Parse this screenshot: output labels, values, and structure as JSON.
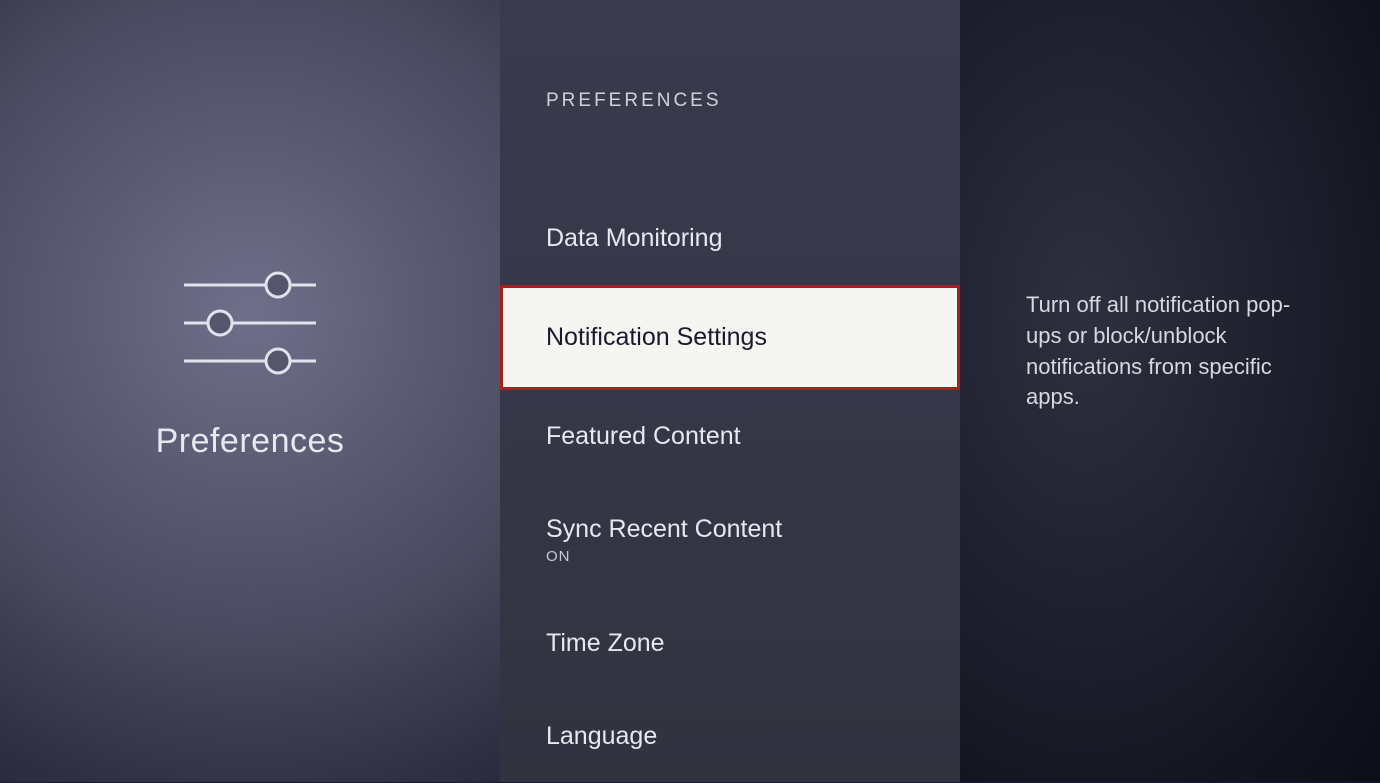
{
  "left": {
    "title": "Preferences"
  },
  "middle": {
    "header": "PREFERENCES",
    "items": [
      {
        "label": "Data Monitoring",
        "sub": "",
        "selected": false
      },
      {
        "label": "Notification Settings",
        "sub": "",
        "selected": true
      },
      {
        "label": "Featured Content",
        "sub": "",
        "selected": false
      },
      {
        "label": "Sync Recent Content",
        "sub": "ON",
        "selected": false
      },
      {
        "label": "Time Zone",
        "sub": "",
        "selected": false
      },
      {
        "label": "Language",
        "sub": "",
        "selected": false
      }
    ]
  },
  "right": {
    "description": "Turn off all notification pop-ups or block/unblock notifications from specific apps."
  }
}
